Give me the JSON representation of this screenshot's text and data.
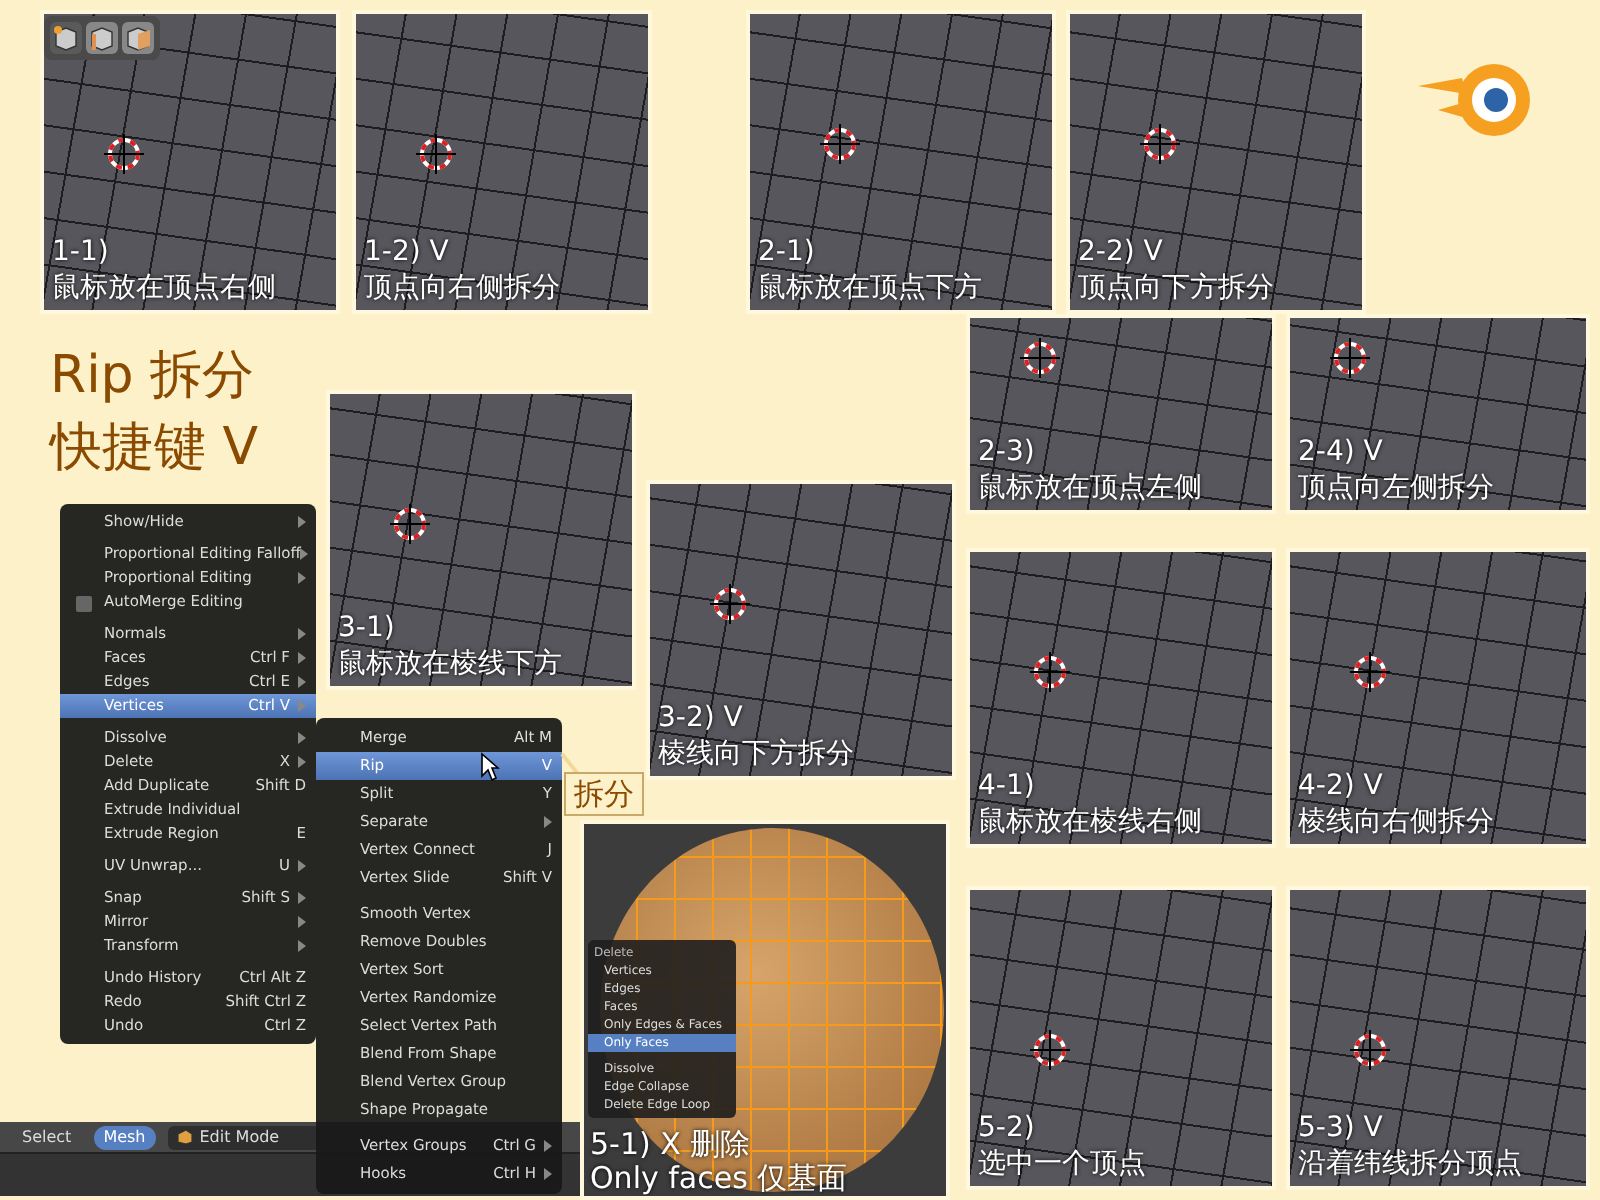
{
  "title": [
    "Rip 拆分",
    "快捷键 V"
  ],
  "select_modes": [
    {
      "kind": "vertex",
      "selected": true
    },
    {
      "kind": "edge",
      "selected": false
    },
    {
      "kind": "face",
      "selected": false
    }
  ],
  "panels": [
    {
      "step": "1-1)",
      "caption": "鼠标放在顶点右侧"
    },
    {
      "step": "1-2) V",
      "caption": "顶点向右侧拆分"
    },
    {
      "step": "2-1)",
      "caption": "鼠标放在顶点下方"
    },
    {
      "step": "2-2) V",
      "caption": "顶点向下方拆分"
    },
    {
      "step": "2-3)",
      "caption": "鼠标放在顶点左侧"
    },
    {
      "step": "2-4) V",
      "caption": "顶点向左侧拆分"
    },
    {
      "step": "3-1)",
      "caption": "鼠标放在棱线下方"
    },
    {
      "step": "3-2) V",
      "caption": "棱线向下方拆分"
    },
    {
      "step": "4-1)",
      "caption": "鼠标放在棱线右侧"
    },
    {
      "step": "4-2) V",
      "caption": "棱线向右侧拆分"
    },
    {
      "step": "5-2)",
      "caption": "选中一个顶点"
    },
    {
      "step": "5-3) V",
      "caption": "沿着纬线拆分顶点"
    }
  ],
  "mesh_menu": {
    "groups": [
      [
        {
          "kind": "item",
          "label": "Show/Hide",
          "submenu": true,
          "selected": false
        }
      ],
      [
        {
          "kind": "item",
          "label": "Proportional Editing Falloff",
          "submenu": true,
          "selected": false
        },
        {
          "kind": "item",
          "label": "Proportional Editing",
          "submenu": true,
          "selected": false
        },
        {
          "kind": "checkbox",
          "label": "AutoMerge Editing",
          "checked": false
        }
      ],
      [
        {
          "kind": "item",
          "label": "Normals",
          "submenu": true,
          "selected": false
        },
        {
          "kind": "item",
          "label": "Faces",
          "shortcut": "Ctrl F",
          "submenu": true,
          "selected": false
        },
        {
          "kind": "item",
          "label": "Edges",
          "shortcut": "Ctrl E",
          "submenu": true,
          "selected": false
        },
        {
          "kind": "item",
          "label": "Vertices",
          "shortcut": "Ctrl V",
          "submenu": true,
          "selected": true
        }
      ],
      [
        {
          "kind": "item",
          "label": "Dissolve",
          "submenu": true,
          "selected": false
        },
        {
          "kind": "item",
          "label": "Delete",
          "shortcut": "X",
          "submenu": true,
          "selected": false
        },
        {
          "kind": "item",
          "label": "Add Duplicate",
          "shortcut": "Shift D",
          "submenu": false,
          "selected": false
        },
        {
          "kind": "item",
          "label": "Extrude Individual",
          "submenu": false,
          "selected": false
        },
        {
          "kind": "item",
          "label": "Extrude Region",
          "shortcut": "E",
          "submenu": false,
          "selected": false
        }
      ],
      [
        {
          "kind": "item",
          "label": "UV Unwrap...",
          "shortcut": "U",
          "submenu": true,
          "selected": false
        }
      ],
      [
        {
          "kind": "item",
          "label": "Snap",
          "shortcut": "Shift S",
          "submenu": true,
          "selected": false
        },
        {
          "kind": "item",
          "label": "Mirror",
          "submenu": true,
          "selected": false
        },
        {
          "kind": "item",
          "label": "Transform",
          "submenu": true,
          "selected": false
        }
      ],
      [
        {
          "kind": "item",
          "label": "Undo History",
          "shortcut": "Ctrl Alt Z",
          "submenu": false,
          "selected": false
        },
        {
          "kind": "item",
          "label": "Redo",
          "shortcut": "Shift Ctrl Z",
          "submenu": false,
          "selected": false
        },
        {
          "kind": "item",
          "label": "Undo",
          "shortcut": "Ctrl Z",
          "submenu": false,
          "selected": false
        }
      ]
    ]
  },
  "vertices_menu": {
    "groups": [
      [
        {
          "kind": "item",
          "label": "Merge",
          "shortcut": "Alt M",
          "submenu": false,
          "selected": false
        },
        {
          "kind": "item",
          "label": "Rip",
          "shortcut": "V",
          "submenu": false,
          "selected": true
        },
        {
          "kind": "item",
          "label": "Split",
          "shortcut": "Y",
          "submenu": false,
          "selected": false
        },
        {
          "kind": "item",
          "label": "Separate",
          "submenu": true,
          "selected": false
        },
        {
          "kind": "item",
          "label": "Vertex Connect",
          "shortcut": "J",
          "submenu": false,
          "selected": false
        },
        {
          "kind": "item",
          "label": "Vertex Slide",
          "shortcut": "Shift V",
          "submenu": false,
          "selected": false
        }
      ],
      [
        {
          "kind": "item",
          "label": "Smooth Vertex",
          "submenu": false,
          "selected": false
        },
        {
          "kind": "item",
          "label": "Remove Doubles",
          "submenu": false,
          "selected": false
        },
        {
          "kind": "item",
          "label": "Vertex Sort",
          "submenu": false,
          "selected": false
        },
        {
          "kind": "item",
          "label": "Vertex Randomize",
          "submenu": false,
          "selected": false
        },
        {
          "kind": "item",
          "label": "Select Vertex Path",
          "submenu": false,
          "selected": false
        },
        {
          "kind": "item",
          "label": "Blend From Shape",
          "submenu": false,
          "selected": false
        },
        {
          "kind": "item",
          "label": "Blend Vertex Group",
          "submenu": false,
          "selected": false
        },
        {
          "kind": "item",
          "label": "Shape Propagate",
          "submenu": false,
          "selected": false
        }
      ],
      [
        {
          "kind": "item",
          "label": "Vertex Groups",
          "shortcut": "Ctrl G",
          "submenu": true,
          "selected": false
        },
        {
          "kind": "item",
          "label": "Hooks",
          "shortcut": "Ctrl H",
          "submenu": true,
          "selected": false
        }
      ]
    ]
  },
  "callout": "拆分",
  "delete_panel": {
    "step": "5-1) X 删除",
    "caption": "Only faces 仅基面",
    "menu_title": "Delete",
    "groups": [
      [
        {
          "label": "Vertices",
          "selected": false
        },
        {
          "label": "Edges",
          "selected": false
        },
        {
          "label": "Faces",
          "selected": false
        },
        {
          "label": "Only Edges & Faces",
          "selected": false
        },
        {
          "label": "Only Faces",
          "selected": true
        }
      ],
      [
        {
          "label": "Dissolve",
          "selected": false
        },
        {
          "label": "Edge Collapse",
          "selected": false
        },
        {
          "label": "Delete Edge Loop",
          "selected": false
        }
      ]
    ]
  },
  "header_bar": {
    "items": [
      {
        "kind": "menu",
        "label": "Select",
        "selected": false
      },
      {
        "kind": "menu",
        "label": "Mesh",
        "selected": true
      },
      {
        "kind": "dropdown",
        "label": "Edit Mode"
      }
    ]
  }
}
